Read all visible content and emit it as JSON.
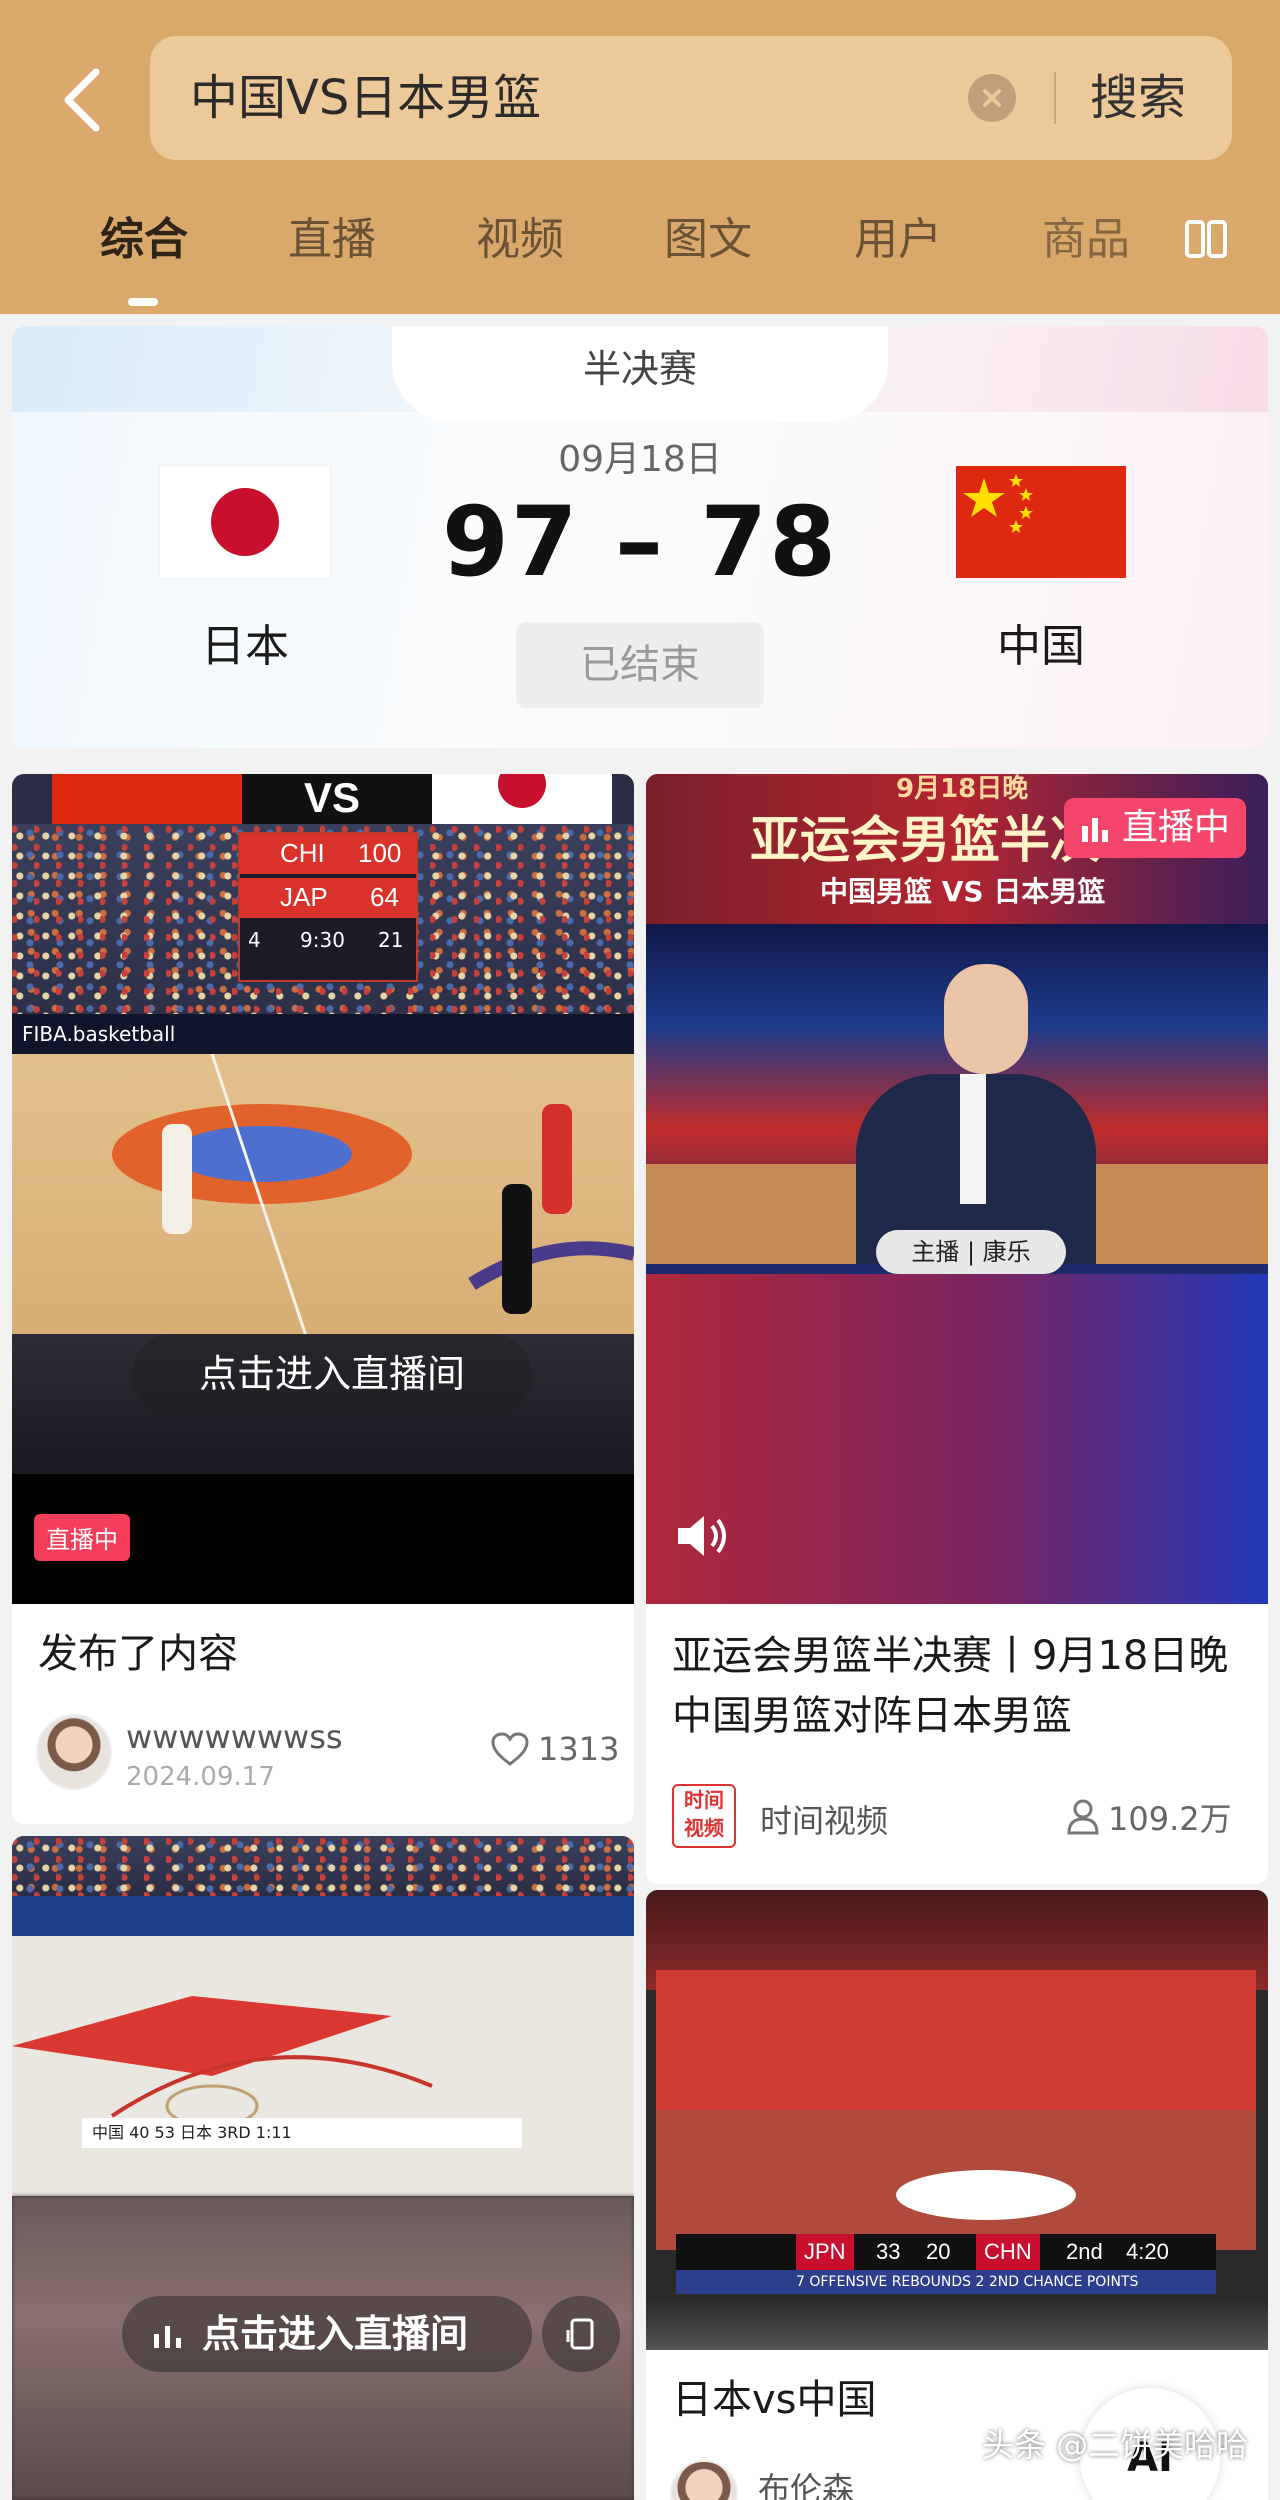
{
  "search": {
    "query": "中国VS日本男篮",
    "button_label": "搜索"
  },
  "tabs": [
    {
      "label": "综合"
    },
    {
      "label": "直播"
    },
    {
      "label": "视频"
    },
    {
      "label": "图文"
    },
    {
      "label": "用户"
    },
    {
      "label": "商品"
    }
  ],
  "match": {
    "stage": "半决赛",
    "date": "09月18日",
    "score": "97 – 78",
    "status": "已结束",
    "team_left": "日本",
    "team_right": "中国"
  },
  "cards": {
    "live_left": {
      "scoreboard_team1": "CHI",
      "scoreboard_score1": "100",
      "scoreboard_team2": "JAP",
      "scoreboard_score2": "64",
      "scoreboard_period": "4",
      "scoreboard_clock": "9:30",
      "scoreboard_shot": "21",
      "ad_text": "FIBA.basketball",
      "enter_label": "点击进入直播间",
      "live_tag": "直播中",
      "title": "发布了内容",
      "author": "wwwwwwwss",
      "date": "2024.09.17",
      "likes": "1313"
    },
    "live_right": {
      "banner_date": "9月18日晚",
      "banner_title": "亚运会男篮半决",
      "banner_sub": "中国男篮 VS 日本男篮",
      "live_badge": "直播中",
      "host_label": "主播 | 康乐",
      "title": "亚运会男篮半决赛丨9月18日晚 中国男篮对阵日本男篮",
      "author": "时间视频",
      "views": "109.2万"
    },
    "bottom_left": {
      "scoreboard": "中国 40 53 日本 3RD 1:11",
      "enter_label": "点击进入直播间"
    },
    "bottom_right": {
      "scoreboard_team1": "JPN",
      "scoreboard_score1": "33",
      "scoreboard_score2": "20",
      "scoreboard_team2": "CHN",
      "scoreboard_period": "2nd",
      "scoreboard_clock": "4:20",
      "scoreboard_note": "7 OFFENSIVE REBOUNDS  2 2ND CHANCE POINTS",
      "title": "日本vs中国",
      "author": "布伦森"
    }
  },
  "watermark": "头条 @二饼美哈哈",
  "ai_badge": "AI",
  "colors": {
    "header_bg": "#d9a86a",
    "live_red": "#f43d5a",
    "china_red": "#de2910",
    "japan_red": "#c8102e"
  }
}
